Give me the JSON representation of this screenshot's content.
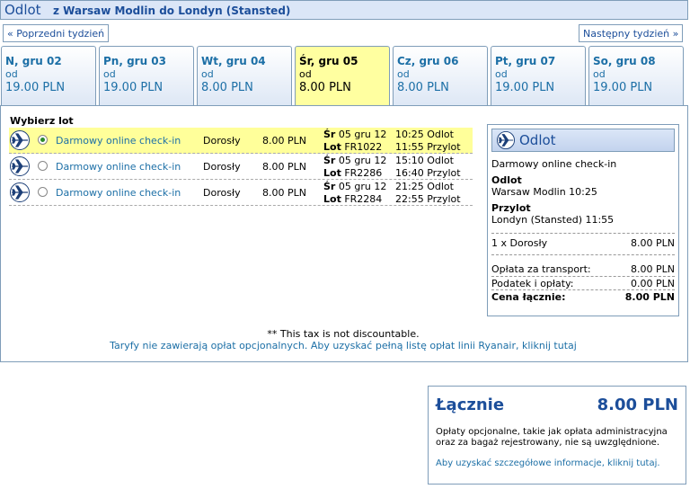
{
  "header": {
    "title": "Odlot",
    "route": "z Warsaw Modlin do Londyn (Stansted)"
  },
  "nav": {
    "prev": "« Poprzedni tydzień",
    "next": "Następny tydzień »"
  },
  "tabs": [
    {
      "day": "N, gru 02",
      "od": "od",
      "price": "19.00 PLN"
    },
    {
      "day": "Pn, gru 03",
      "od": "od",
      "price": "19.00 PLN"
    },
    {
      "day": "Wt, gru 04",
      "od": "od",
      "price": "8.00 PLN"
    },
    {
      "day": "Śr, gru 05",
      "od": "od",
      "price": "8.00 PLN"
    },
    {
      "day": "Cz, gru 06",
      "od": "od",
      "price": "8.00 PLN"
    },
    {
      "day": "Pt, gru 07",
      "od": "od",
      "price": "19.00 PLN"
    },
    {
      "day": "So, gru 08",
      "od": "od",
      "price": "19.00 PLN"
    }
  ],
  "flights_title": "Wybierz lot",
  "flights": [
    {
      "fare": "Darmowy online check-in",
      "pax": "Dorosły",
      "price": "8.00 PLN",
      "day": "Śr",
      "date": "05 gru 12",
      "lot": "Lot",
      "flight": "FR1022",
      "dep_time": "10:25",
      "dep_label": "Odlot",
      "arr_time": "11:55",
      "arr_label": "Przylot"
    },
    {
      "fare": "Darmowy online check-in",
      "pax": "Dorosły",
      "price": "8.00 PLN",
      "day": "Śr",
      "date": "05 gru 12",
      "lot": "Lot",
      "flight": "FR2286",
      "dep_time": "15:10",
      "dep_label": "Odlot",
      "arr_time": "16:40",
      "arr_label": "Przylot"
    },
    {
      "fare": "Darmowy online check-in",
      "pax": "Dorosły",
      "price": "8.00 PLN",
      "day": "Śr",
      "date": "05 gru 12",
      "lot": "Lot",
      "flight": "FR2284",
      "dep_time": "21:25",
      "dep_label": "Odlot",
      "arr_time": "22:55",
      "arr_label": "Przylot"
    }
  ],
  "summary": {
    "title": "Odlot",
    "fare": "Darmowy online check-in",
    "dep_label": "Odlot",
    "dep_value": "Warsaw Modlin 10:25",
    "arr_label": "Przylot",
    "arr_value": "Londyn (Stansted) 11:55",
    "pax_line": "1 x Dorosły",
    "pax_price": "8.00 PLN",
    "transport_label": "Opłata za transport:",
    "transport_value": "8.00 PLN",
    "tax_label": "Podatek i opłaty:",
    "tax_value": "0.00 PLN",
    "total_label": "Cena łącznie:",
    "total_value": "8.00 PLN"
  },
  "notes": {
    "tax": "** This tax is not discountable.",
    "link": "Taryfy nie zawierają opłat opcjonalnych. Aby uzyskać pełną listę opłat linii Ryanair, kliknij tutaj"
  },
  "total": {
    "label": "Łącznie",
    "value": "8.00 PLN",
    "text": "Opłaty opcjonalne, takie jak opłata administracyjna oraz za bagaż rejestrowany, nie są uwzględnione.",
    "link": "Aby uzyskać szczegółowe informacje, kliknij tutaj."
  },
  "colors": {
    "accent": "#1c4e9a",
    "link": "#1c6fa6",
    "selected": "#ffff9a",
    "border": "#7f9db9"
  },
  "selected_tab": 3,
  "selected_flight": 0
}
